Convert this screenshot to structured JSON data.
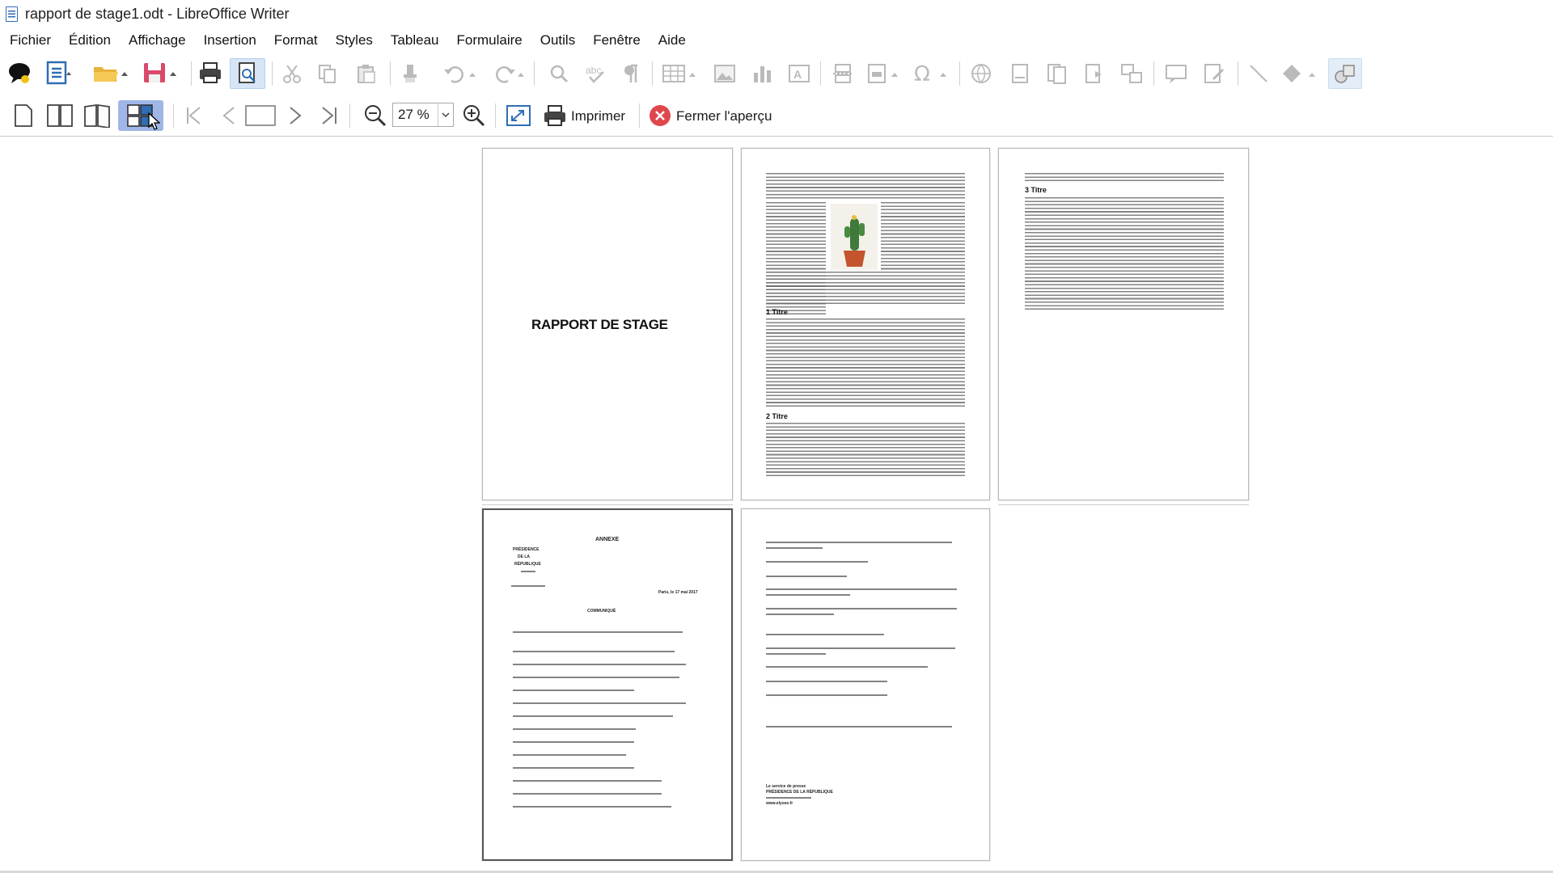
{
  "window": {
    "title": "rapport de stage1.odt - LibreOffice Writer"
  },
  "menu": [
    "Fichier",
    "Édition",
    "Affichage",
    "Insertion",
    "Format",
    "Styles",
    "Tableau",
    "Formulaire",
    "Outils",
    "Fenêtre",
    "Aide"
  ],
  "preview_toolbar": {
    "zoom_value": "27 %",
    "print_label": "Imprimer",
    "close_preview_label": "Fermer l'aperçu"
  },
  "pages": {
    "page1": {
      "title": "RAPPORT DE STAGE"
    },
    "page2": {
      "heading1": "1 Titre",
      "heading2": "2 Titre"
    },
    "page3": {
      "heading3": "3 Titre"
    },
    "page4": {
      "title": "ANNEXE",
      "left_header": [
        "PRÉSIDENCE",
        "DE LA",
        "RÉPUBLIQUE"
      ],
      "place_date": "Paris, le 17 mai 2017",
      "subtitle": "COMMUNIQUÉ"
    },
    "page5": {
      "footer": [
        "Le service de presse",
        "PRÉSIDENCE DE LA RÉPUBLIQUE",
        "www.elysee.fr"
      ]
    }
  },
  "colors": {
    "accent": "#2f6db5",
    "close_red": "#e0474c",
    "selection": "#9fb6e6"
  }
}
